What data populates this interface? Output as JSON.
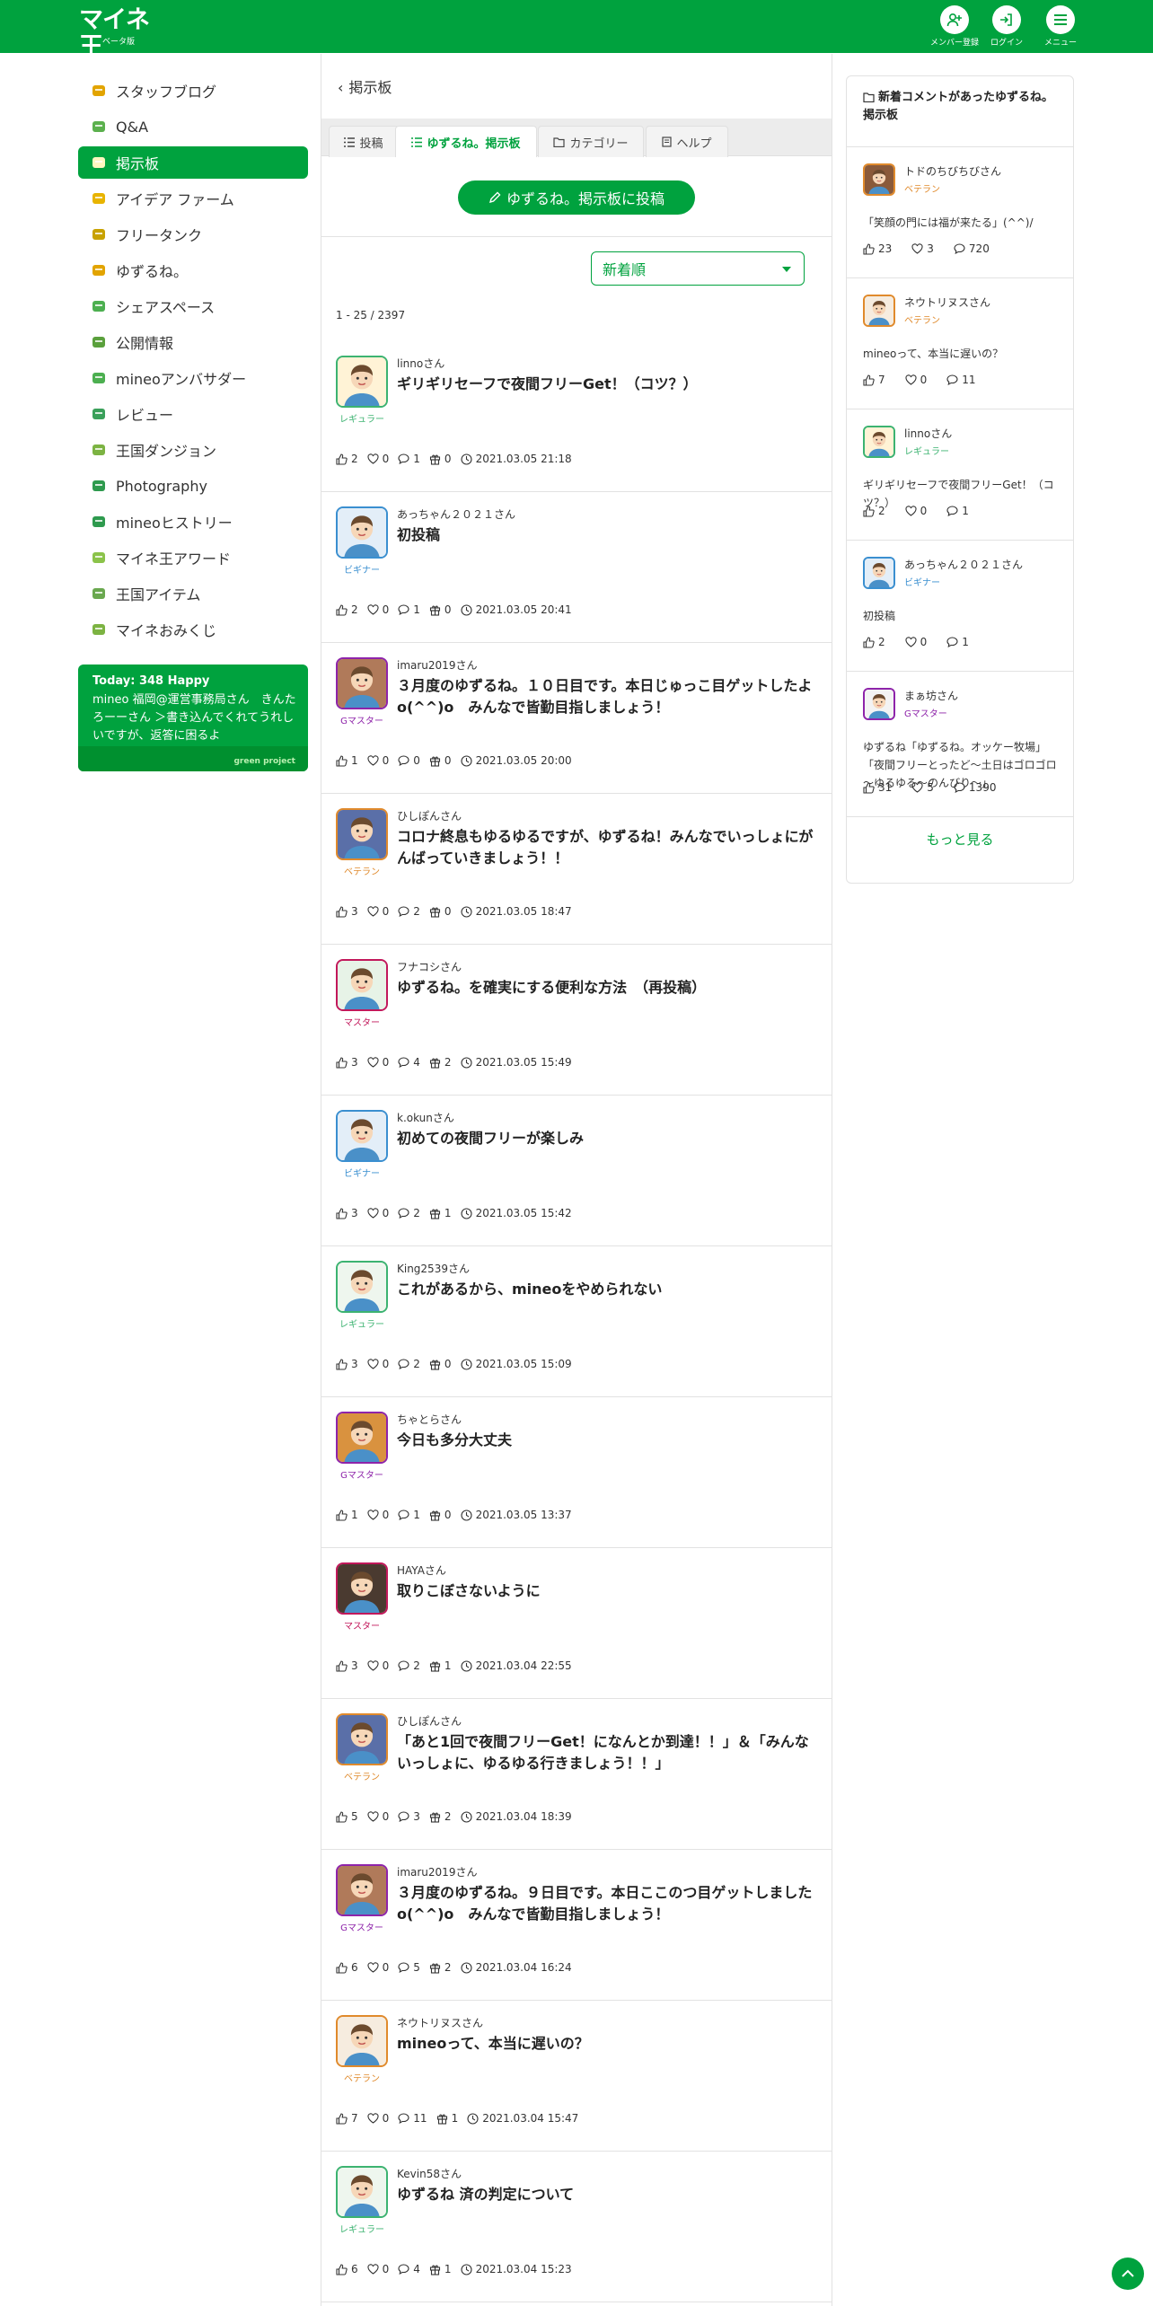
{
  "header": {
    "logo_text": "マイネ王",
    "logo_sub": "ベータ版",
    "member_label": "メンバー登録",
    "login_label": "ログイン",
    "menu_label": "メニュー"
  },
  "colors": {
    "brand": "#00a23e",
    "regular": "#3cb371",
    "beginner": "#3a8fd0",
    "veteran": "#e08a2c",
    "master": "#c2185b",
    "gmaster": "#8e24aa"
  },
  "sidebar": {
    "items": [
      {
        "label": "スタッフブログ",
        "icon": "staff-blog-icon",
        "color": "#e2a400",
        "active": false
      },
      {
        "label": "Q&A",
        "icon": "qa-icon",
        "color": "#5bb04d",
        "active": false
      },
      {
        "label": "掲示板",
        "icon": "board-icon",
        "color": "#f2c200",
        "active": true
      },
      {
        "label": "アイデア ファーム",
        "icon": "idea-farm-icon",
        "color": "#e8b400",
        "active": false
      },
      {
        "label": "フリータンク",
        "icon": "free-tank-icon",
        "color": "#c8a200",
        "active": false
      },
      {
        "label": "ゆずるね。",
        "icon": "yuzurune-icon",
        "color": "#e2a400",
        "active": false
      },
      {
        "label": "シェアスペース",
        "icon": "share-space-icon",
        "color": "#4caf50",
        "active": false
      },
      {
        "label": "公開情報",
        "icon": "public-info-icon",
        "color": "#5aa03c",
        "active": false
      },
      {
        "label": "mineoアンバサダー",
        "icon": "ambassador-icon",
        "color": "#4caf50",
        "active": false
      },
      {
        "label": "レビュー",
        "icon": "review-icon",
        "color": "#3aa05a",
        "active": false
      },
      {
        "label": "王国ダンジョン",
        "icon": "dungeon-icon",
        "color": "#7cb342",
        "active": false
      },
      {
        "label": "Photography",
        "icon": "camera-icon",
        "color": "#2e9a4e",
        "active": false
      },
      {
        "label": "mineoヒストリー",
        "icon": "history-icon",
        "color": "#2e9a4e",
        "active": false
      },
      {
        "label": "マイネ王アワード",
        "icon": "trophy-icon",
        "color": "#8bc34a",
        "active": false
      },
      {
        "label": "王国アイテム",
        "icon": "item-icon",
        "color": "#6aa84f",
        "active": false
      },
      {
        "label": "マイネおみくじ",
        "icon": "omikuji-icon",
        "color": "#7cb342",
        "active": false
      }
    ],
    "happy": {
      "title": "Today: 348 Happy",
      "body": "mineo 福岡@運営事務局さん　きんたろーーさん ＞書き込んでくれてうれしいですが、返答に困るよ",
      "footer": "green project"
    }
  },
  "main": {
    "back_label": "掲示板",
    "tabs": [
      {
        "label": "投稿",
        "icon": "list-icon"
      },
      {
        "label": "ゆずるね。掲示板",
        "icon": "list-icon"
      },
      {
        "label": "カテゴリー",
        "icon": "folder-icon"
      },
      {
        "label": "ヘルプ",
        "icon": "book-icon"
      }
    ],
    "post_button": "ゆずるね。掲示板に投稿",
    "sort_value": "新着順",
    "count": "1 - 25 / 2397",
    "posts": [
      {
        "author": "linnoさん",
        "rank": "レギュラー",
        "rank_color": "#3cb371",
        "title": "ギリギリセーフで夜間フリーGet！（コツ？）",
        "likes": "2",
        "hearts": "0",
        "comments": "1",
        "gifts": "0",
        "date": "2021.03.05 21:18",
        "avatar_bg": "#fff3d6"
      },
      {
        "author": "あっちゃん２０２１さん",
        "rank": "ビギナー",
        "rank_color": "#3a8fd0",
        "title": "初投稿",
        "likes": "2",
        "hearts": "0",
        "comments": "1",
        "gifts": "0",
        "date": "2021.03.05 20:41",
        "avatar_bg": "#e3eef8"
      },
      {
        "author": "imaru2019さん",
        "rank": "Gマスター",
        "rank_color": "#8e24aa",
        "title": "３月度のゆずるね。１０日目です。本日じゅっこ目ゲットしたよo(^^)o　みんなで皆勤目指しましょう！",
        "likes": "1",
        "hearts": "0",
        "comments": "0",
        "gifts": "0",
        "date": "2021.03.05 20:00",
        "avatar_bg": "#b07a5a"
      },
      {
        "author": "ひしぽんさん",
        "rank": "ベテラン",
        "rank_color": "#e08a2c",
        "title": "コロナ終息もゆるゆるですが、ゆずるね！みんなでいっしょにがんばっていきましょう！！",
        "likes": "3",
        "hearts": "0",
        "comments": "2",
        "gifts": "0",
        "date": "2021.03.05 18:47",
        "avatar_bg": "#5a6fa8"
      },
      {
        "author": "フナコシさん",
        "rank": "マスター",
        "rank_color": "#c2185b",
        "title": "ゆずるね。を確実にする便利な方法　（再投稿）",
        "likes": "3",
        "hearts": "0",
        "comments": "4",
        "gifts": "2",
        "date": "2021.03.05 15:49",
        "avatar_bg": "#e7f3e7"
      },
      {
        "author": "k.okunさん",
        "rank": "ビギナー",
        "rank_color": "#3a8fd0",
        "title": "初めての夜間フリーが楽しみ",
        "likes": "3",
        "hearts": "0",
        "comments": "2",
        "gifts": "1",
        "date": "2021.03.05 15:42",
        "avatar_bg": "#e3eef8"
      },
      {
        "author": "King2539さん",
        "rank": "レギュラー",
        "rank_color": "#3cb371",
        "title": "これがあるから、mineoをやめられない",
        "likes": "3",
        "hearts": "0",
        "comments": "2",
        "gifts": "0",
        "date": "2021.03.05 15:09",
        "avatar_bg": "#eef6ee"
      },
      {
        "author": "ちゃとらさん",
        "rank": "Gマスター",
        "rank_color": "#8e24aa",
        "title": "今日も多分大丈夫",
        "likes": "1",
        "hearts": "0",
        "comments": "1",
        "gifts": "0",
        "date": "2021.03.05 13:37",
        "avatar_bg": "#d9923f"
      },
      {
        "author": "HAYAさん",
        "rank": "マスター",
        "rank_color": "#c2185b",
        "title": "取りこぼさないように",
        "likes": "3",
        "hearts": "0",
        "comments": "2",
        "gifts": "1",
        "date": "2021.03.04 22:55",
        "avatar_bg": "#4a3a30"
      },
      {
        "author": "ひしぽんさん",
        "rank": "ベテラン",
        "rank_color": "#e08a2c",
        "title": "「あと1回で夜間フリーGet！になんとか到達！！」＆「みんないっしょに、ゆるゆる行きましょう！！」",
        "likes": "5",
        "hearts": "0",
        "comments": "3",
        "gifts": "2",
        "date": "2021.03.04 18:39",
        "avatar_bg": "#5a6fa8"
      },
      {
        "author": "imaru2019さん",
        "rank": "Gマスター",
        "rank_color": "#8e24aa",
        "title": "３月度のゆずるね。９日目です。本日ここのつ目ゲットしましたo(^^)o　みんなで皆勤目指しましょう！",
        "likes": "6",
        "hearts": "0",
        "comments": "5",
        "gifts": "2",
        "date": "2021.03.04 16:24",
        "avatar_bg": "#b07a5a"
      },
      {
        "author": "ネウトリヌスさん",
        "rank": "ベテラン",
        "rank_color": "#e08a2c",
        "title": "mineoって、本当に遅いの？",
        "likes": "7",
        "hearts": "0",
        "comments": "11",
        "gifts": "1",
        "date": "2021.03.04 15:47",
        "avatar_bg": "#f6ecdf"
      },
      {
        "author": "Kevin58さん",
        "rank": "レギュラー",
        "rank_color": "#3cb371",
        "title": "ゆずるね 済の判定について",
        "likes": "6",
        "hearts": "0",
        "comments": "4",
        "gifts": "1",
        "date": "2021.03.04 15:23",
        "avatar_bg": "#eef6ee"
      }
    ]
  },
  "right": {
    "heading": "新着コメントがあったゆずるね。掲示板",
    "items": [
      {
        "name": "トドのちびちびさん",
        "rank": "ベテラン",
        "rank_color": "#e08a2c",
        "body": "「笑顔の門には福が来たる」(^^)/",
        "likes": "23",
        "hearts": "3",
        "comments": "720",
        "avatar_bg": "#8a5a3a"
      },
      {
        "name": "ネウトリヌスさん",
        "rank": "ベテラン",
        "rank_color": "#e08a2c",
        "body": "mineoって、本当に遅いの？",
        "likes": "7",
        "hearts": "0",
        "comments": "11",
        "avatar_bg": "#f6ecdf"
      },
      {
        "name": "linnoさん",
        "rank": "レギュラー",
        "rank_color": "#3cb371",
        "body": "ギリギリセーフで夜間フリーGet！（コツ？）",
        "likes": "2",
        "hearts": "0",
        "comments": "1",
        "avatar_bg": "#fff3d6"
      },
      {
        "name": "あっちゃん２０２１さん",
        "rank": "ビギナー",
        "rank_color": "#3a8fd0",
        "body": "初投稿",
        "likes": "2",
        "hearts": "0",
        "comments": "1",
        "avatar_bg": "#e3eef8"
      },
      {
        "name": "まぁ坊さん",
        "rank": "Gマスター",
        "rank_color": "#8e24aa",
        "body": "ゆずるね「ゆずるね。オッケー牧場」「夜間フリーとったど～土日はゴロゴロ～ゆるゆる～のんびり～」",
        "likes": "31",
        "hearts": "5",
        "comments": "1390",
        "avatar_bg": "#f3f3f3"
      }
    ],
    "more_label": "もっと見る"
  }
}
